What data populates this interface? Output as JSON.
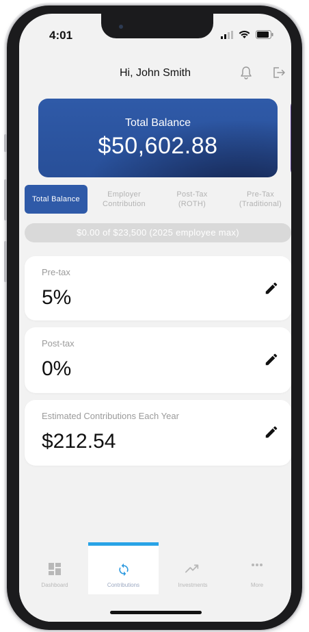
{
  "status_bar": {
    "time": "4:01"
  },
  "header": {
    "greeting": "Hi, John Smith"
  },
  "balance_card": {
    "label": "Total Balance",
    "amount": "$50,602.88"
  },
  "tabs": [
    {
      "label": "Total Balance",
      "active": true
    },
    {
      "label": "Employer Contribution",
      "active": false
    },
    {
      "label": "Post-Tax (ROTH)",
      "active": false
    },
    {
      "label": "Pre-Tax (Traditional)",
      "active": false
    }
  ],
  "limit_bar": {
    "text": "$0.00 of $23,500 (2025 employee max)"
  },
  "cards": [
    {
      "label": "Pre-tax",
      "value": "5%"
    },
    {
      "label": "Post-tax",
      "value": "0%"
    },
    {
      "label": "Estimated Contributions Each Year",
      "value": "$212.54"
    }
  ],
  "bottom_nav": [
    {
      "label": "Dashboard",
      "icon": "dashboard-grid-icon",
      "active": false
    },
    {
      "label": "Contributions",
      "icon": "sync-arrows-icon",
      "active": true
    },
    {
      "label": "Investments",
      "icon": "trending-up-icon",
      "active": false
    },
    {
      "label": "More",
      "icon": "more-dots-icon",
      "active": false
    }
  ],
  "colors": {
    "primary_blue": "#2f5aa8",
    "accent_purple": "#5a3e92",
    "active_indicator": "#29a3e6",
    "background": "#f2f2f2"
  }
}
